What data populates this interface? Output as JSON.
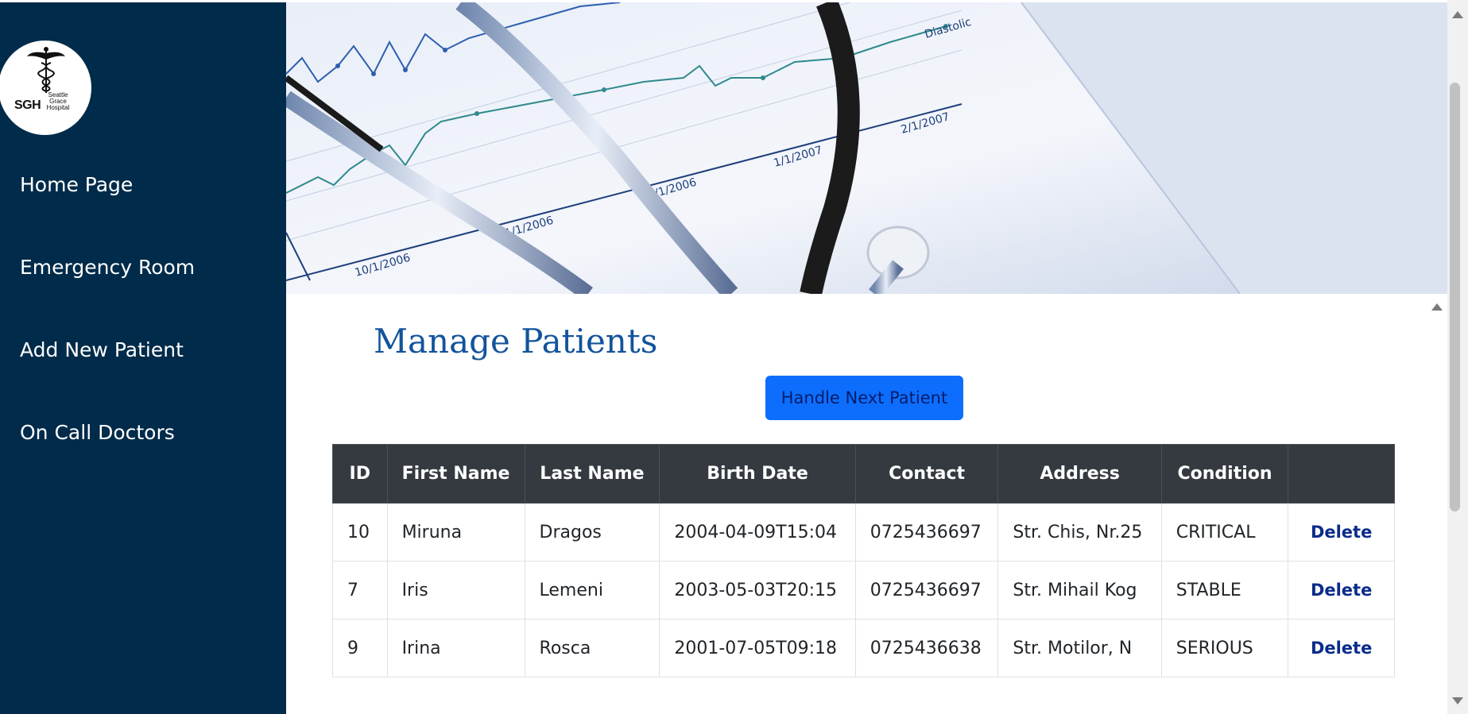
{
  "sidebar": {
    "logo": {
      "main": "SGH",
      "sub": [
        "Seattle",
        "Grace",
        "Hospital"
      ]
    },
    "items": [
      {
        "label": "Home Page"
      },
      {
        "label": "Emergency Room"
      },
      {
        "label": "Add New Patient"
      },
      {
        "label": "On Call Doctors"
      }
    ]
  },
  "banner": {
    "chart_labels": [
      "10/1/2006",
      "11/1/2006",
      "12/1/2006",
      "1/1/2007",
      "2/1/2007",
      "Diastolic"
    ]
  },
  "main": {
    "title": "Manage Patients",
    "next_button": "Handle Next Patient",
    "table": {
      "headers": [
        "ID",
        "First Name",
        "Last Name",
        "Birth Date",
        "Contact",
        "Address",
        "Condition",
        ""
      ],
      "rows": [
        {
          "id": "10",
          "first": "Miruna",
          "last": "Dragos",
          "birth": "2004-04-09T15:04",
          "contact": "0725436697",
          "address": "Str. Chis, Nr.25",
          "condition": "CRITICAL",
          "action": "Delete"
        },
        {
          "id": "7",
          "first": "Iris",
          "last": "Lemeni",
          "birth": "2003-05-03T20:15",
          "contact": "0725436697",
          "address": "Str. Mihail Kog",
          "condition": "STABLE",
          "action": "Delete"
        },
        {
          "id": "9",
          "first": "Irina",
          "last": "Rosca",
          "birth": "2001-07-05T09:18",
          "contact": "0725436638",
          "address": "Str. Motilor, N",
          "condition": "SERIOUS",
          "action": "Delete"
        }
      ]
    }
  },
  "colors": {
    "sidebar_bg": "#002b4a",
    "title": "#12539c",
    "button_bg": "#0d6efd",
    "table_header_bg": "#343a40"
  }
}
